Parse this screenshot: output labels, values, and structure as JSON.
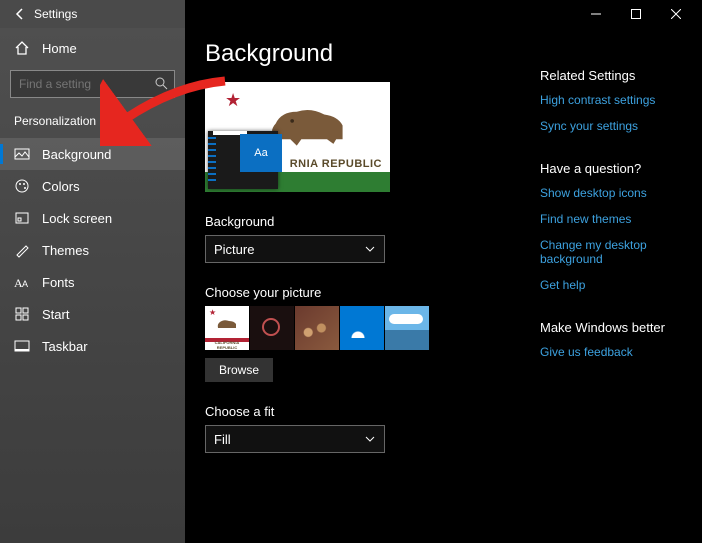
{
  "titlebar": {
    "title": "Settings"
  },
  "sidebar": {
    "home": "Home",
    "search_placeholder": "Find a setting",
    "section": "Personalization",
    "items": [
      {
        "label": "Background",
        "icon": "image-icon",
        "active": true
      },
      {
        "label": "Colors",
        "icon": "palette-icon"
      },
      {
        "label": "Lock screen",
        "icon": "lockscreen-icon"
      },
      {
        "label": "Themes",
        "icon": "brush-icon"
      },
      {
        "label": "Fonts",
        "icon": "font-icon"
      },
      {
        "label": "Start",
        "icon": "start-icon"
      },
      {
        "label": "Taskbar",
        "icon": "taskbar-icon"
      }
    ]
  },
  "main": {
    "page_title": "Background",
    "preview": {
      "flag_text": "RNIA REPUBLIC",
      "tile_hint": "Aa"
    },
    "background_label": "Background",
    "background_value": "Picture",
    "choose_picture_label": "Choose your picture",
    "thumb0_text": "CALIFORNIA REPUBLIC",
    "browse_label": "Browse",
    "fit_label": "Choose a fit",
    "fit_value": "Fill"
  },
  "right": {
    "related_title": "Related Settings",
    "related_links": [
      "High contrast settings",
      "Sync your settings"
    ],
    "question_title": "Have a question?",
    "question_links": [
      "Show desktop icons",
      "Find new themes",
      "Change my desktop background",
      "Get help"
    ],
    "better_title": "Make Windows better",
    "better_links": [
      "Give us feedback"
    ]
  }
}
